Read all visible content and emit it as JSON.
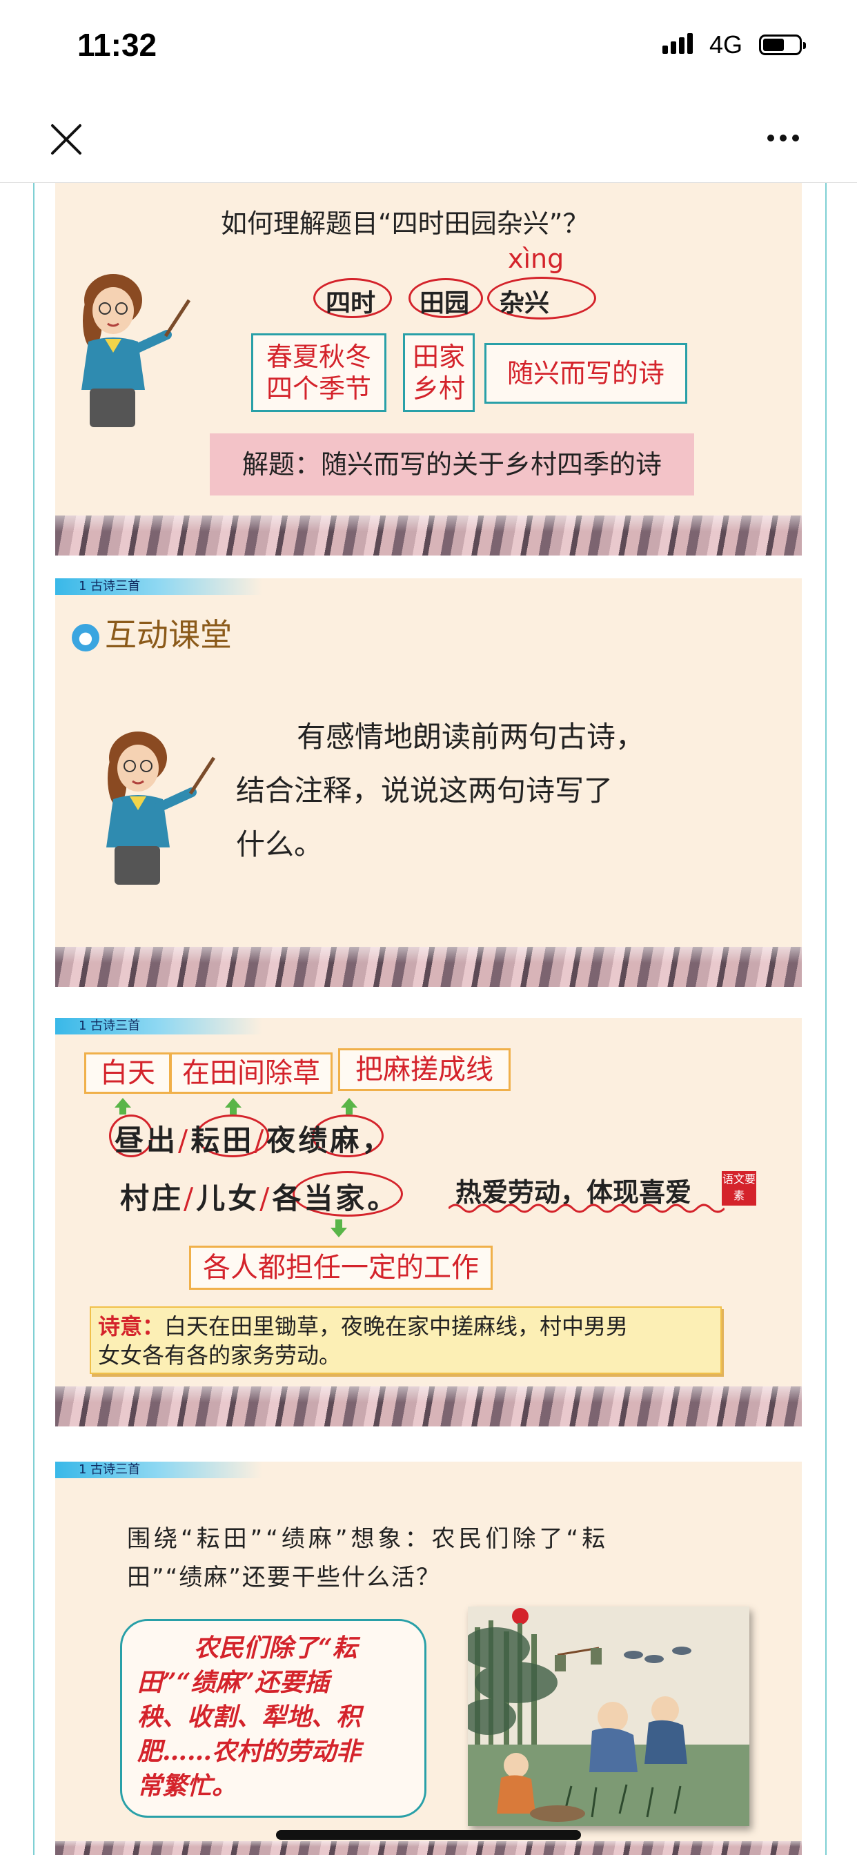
{
  "status": {
    "time": "11:32",
    "network": "4G"
  },
  "nav": {
    "close_icon": "close-icon",
    "more_icon": "more-dots-icon"
  },
  "slide1": {
    "question": "如何理解题目“四时田园杂兴”？",
    "pinyin": "xìng",
    "words": [
      "四时",
      "田园",
      "杂兴"
    ],
    "boxes": [
      {
        "line1": "春夏秋冬",
        "line2": "四个季节"
      },
      {
        "line1": "田家",
        "line2": "乡村"
      },
      {
        "line1": "随兴而写的诗",
        "line2": ""
      }
    ],
    "explain": "解题：随兴而写的关于乡村四季的诗"
  },
  "slide2": {
    "tag": "1 古诗三首",
    "heading": "互动课堂",
    "line1": "有感情地朗读前两句古诗，",
    "line2": "结合注释，说说这两句诗写了",
    "line3": "什么。"
  },
  "slide3": {
    "tag": "1 古诗三首",
    "box_baitian": "白天",
    "box_chu": "在田间除草",
    "box_ma": "把麻搓成线",
    "poem1": [
      "昼",
      "出",
      "/",
      "耘",
      "田",
      "/",
      "夜",
      "绩",
      "麻",
      "，"
    ],
    "poem2": [
      "村",
      "庄",
      "/",
      "儿",
      "女",
      "/",
      "各",
      "当",
      "家",
      "。"
    ],
    "theme": "热爱劳动，体现喜爱",
    "stamp": "语文要素",
    "box_gedang": "各人都担任一定的工作",
    "meaning_label": "诗意：",
    "meaning_text1": "白天在田里锄草，夜晚在家中搓麻线，村中男男",
    "meaning_text2": "女女各有各的家务劳动。"
  },
  "slide4": {
    "tag": "1 古诗三首",
    "q1": "围绕“耘田”“绩麻”想象：农民们除了“耘",
    "q2": "田”“绩麻”还要干些什么活？",
    "a1": "农民们除了“耘",
    "a2": "田”“绩麻”还要插",
    "a3": "秧、收割、犁地、积",
    "a4": "肥……农村的劳动非",
    "a5": "常繁忙。"
  }
}
